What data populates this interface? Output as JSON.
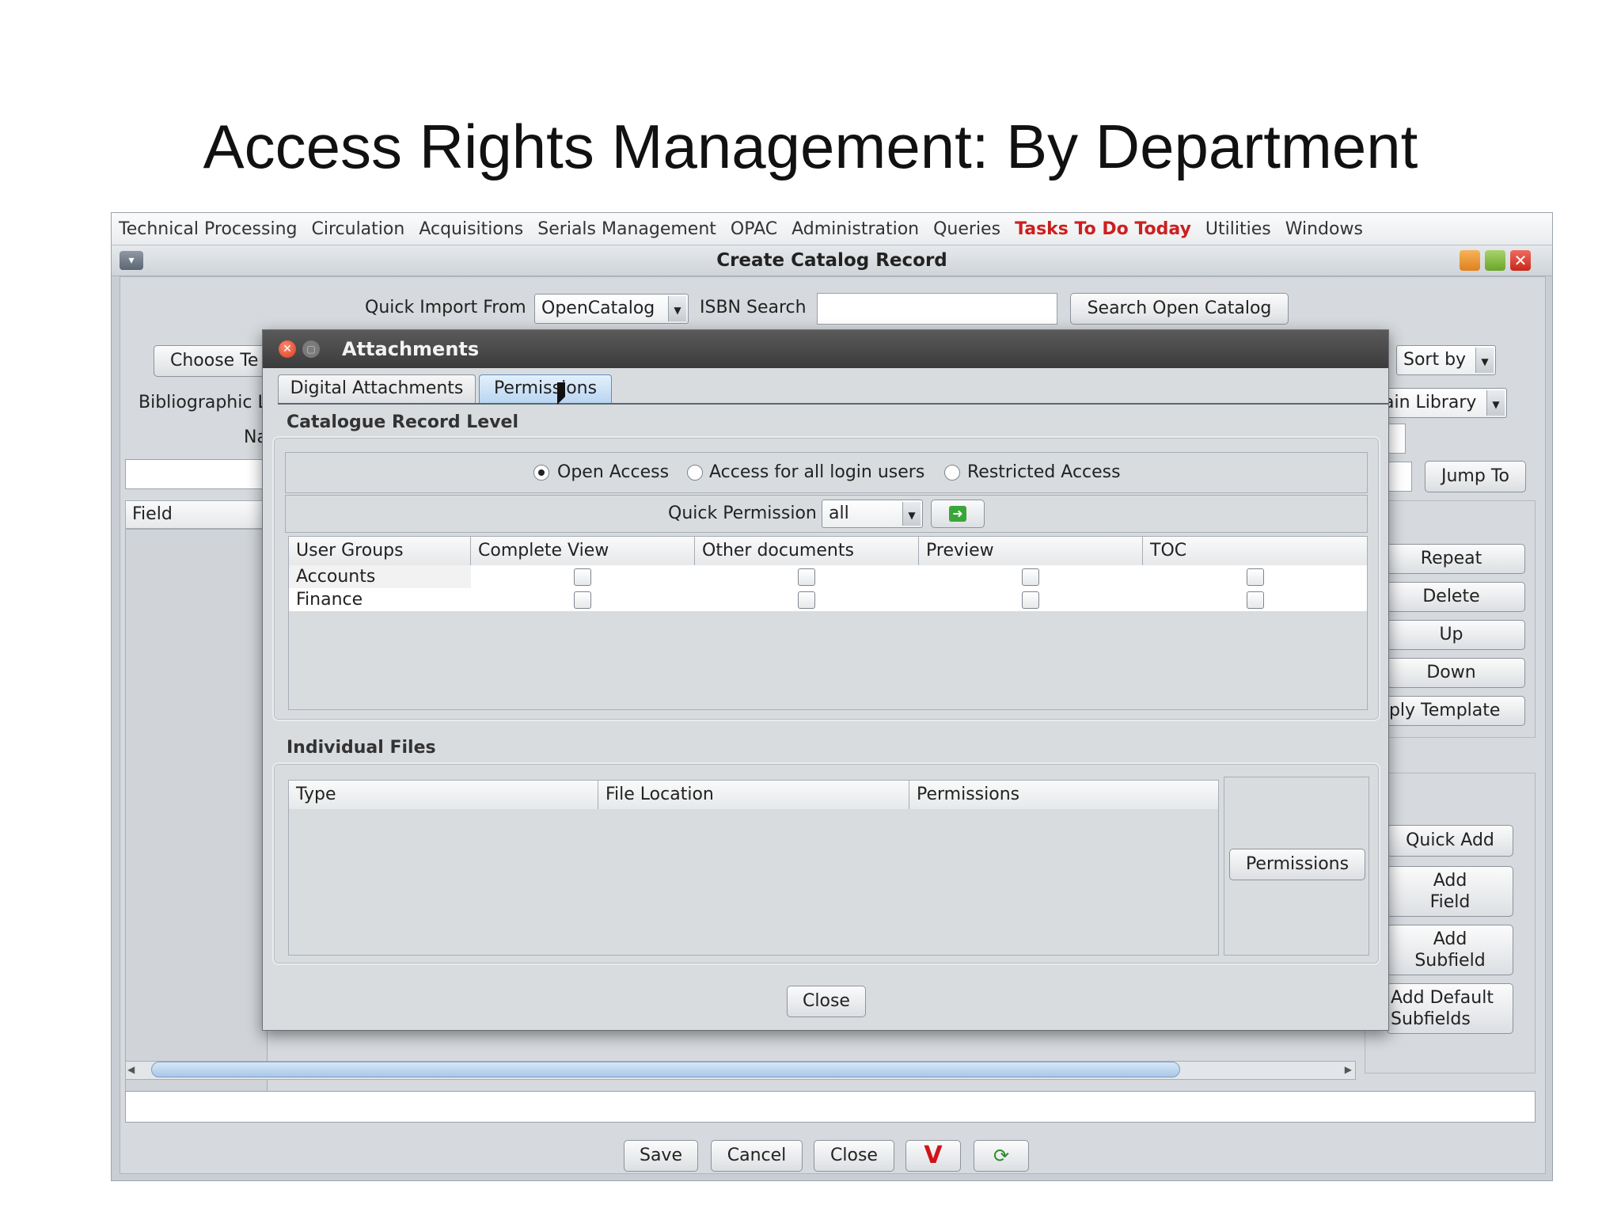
{
  "slide": {
    "title": "Access Rights Management: By Department"
  },
  "menu": [
    "Technical Processing",
    "Circulation",
    "Acquisitions",
    "Serials Management",
    "OPAC",
    "Administration",
    "Queries",
    "Tasks To Do Today",
    "Utilities",
    "Windows"
  ],
  "window": {
    "title": "Create Catalog Record"
  },
  "catalog": {
    "quick_import_label": "Quick Import From",
    "quick_import_value": "OpenCatalog",
    "isbn_label": "ISBN Search",
    "isbn_value": "",
    "search_button": "Search Open Catalog",
    "choose_template": "Choose Te",
    "bibliographic_label": "Bibliographic L",
    "na_label": "Na",
    "sort_by": "Sort by",
    "library": "ain Library",
    "jump_to": "Jump To",
    "field_header": "Field",
    "side_buttons": [
      "Repeat",
      "Delete",
      "Up",
      "Down",
      "pply Template"
    ],
    "add_buttons": [
      "Quick Add",
      "Add\nField",
      "Add\nSubfield",
      "Add Default\nSubfields"
    ],
    "bottom_buttons": [
      "Save",
      "Cancel",
      "Close"
    ]
  },
  "dialog": {
    "title": "Attachments",
    "tabs": [
      "Digital Attachments",
      "Permissions"
    ],
    "active_tab": "Permissions",
    "record_level_label": "Catalogue Record Level",
    "access_options": [
      "Open Access",
      "Access for all login users",
      "Restricted Access"
    ],
    "selected_access": "Open Access",
    "quick_permission_label": "Quick Permission",
    "quick_permission_value": "all",
    "table_headers": [
      "User Groups",
      "Complete View",
      "Other documents",
      "Preview",
      "TOC"
    ],
    "table_rows": [
      {
        "group": "Accounts",
        "complete_view": false,
        "other_documents": false,
        "preview": false,
        "toc": false
      },
      {
        "group": "Finance",
        "complete_view": false,
        "other_documents": false,
        "preview": false,
        "toc": false
      }
    ],
    "individual_files_label": "Individual Files",
    "file_headers": [
      "Type",
      "File Location",
      "Permissions"
    ],
    "permissions_button": "Permissions",
    "close_button": "Close"
  },
  "colors": {
    "accent_tab": "#b9d6f2",
    "hot_menu": "#cc1f1f",
    "dialog_title": "#3b3b3b"
  }
}
